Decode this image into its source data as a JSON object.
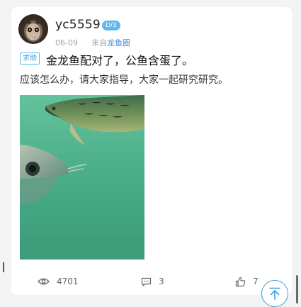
{
  "post": {
    "author": {
      "name": "yc5559",
      "level": "LV3"
    },
    "meta": {
      "date": "06-09",
      "source_prefix": "来自",
      "source_name": "龙鱼圈"
    },
    "tag": "求助",
    "title": "金龙鱼配对了，公鱼含蛋了。",
    "body": "应该怎么办，请大家指导，大家一起研究研究。"
  },
  "stats": {
    "views": "4701",
    "comments": "3",
    "likes": "7"
  },
  "colors": {
    "accent": "#3d9fe0",
    "badge": "#5fb8ee",
    "link": "#3d8fd6",
    "muted": "#a0a4a8"
  },
  "icons": {
    "views": "eye-icon",
    "comments": "comment-icon",
    "likes": "thumbs-up-icon",
    "scroll_top": "arrow-up-icon"
  }
}
